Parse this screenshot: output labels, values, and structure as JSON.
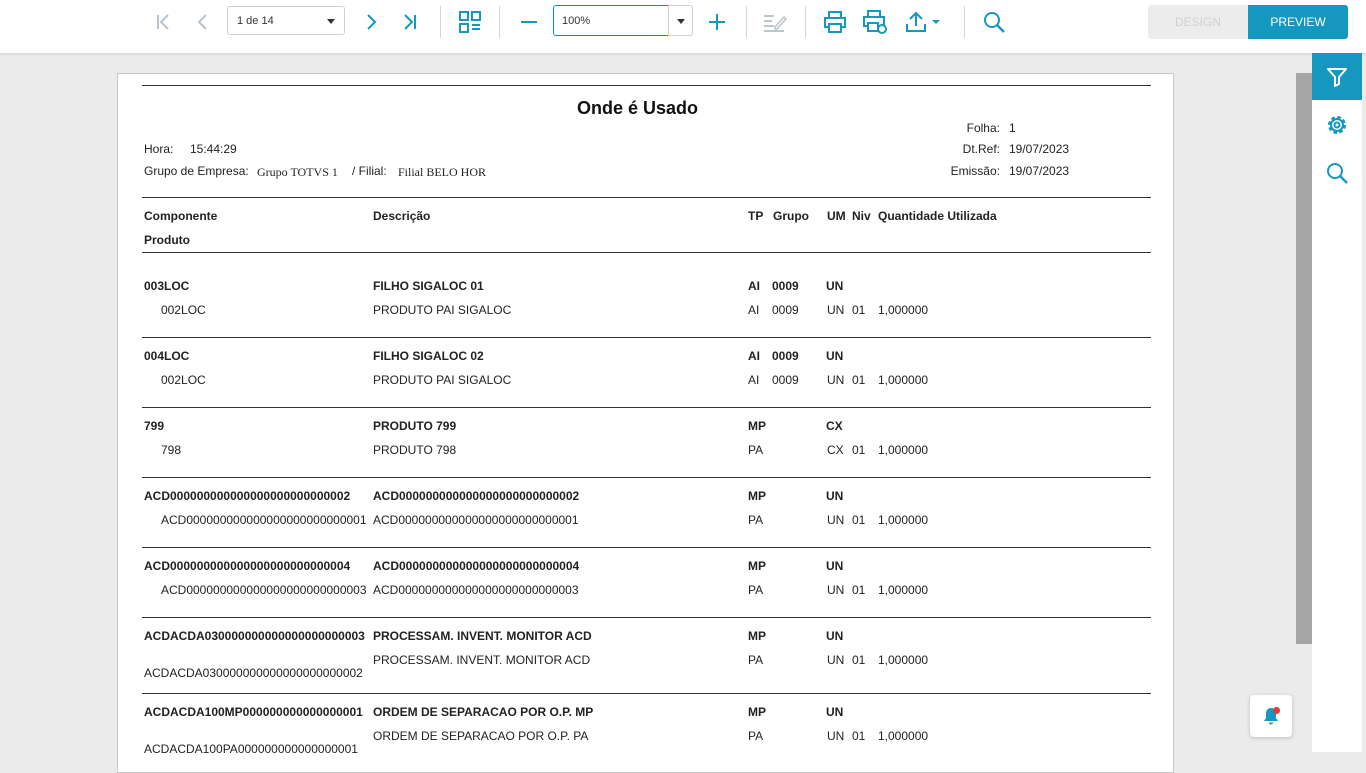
{
  "toolbar": {
    "page_select_value": "1 de 14",
    "zoom_value": "100%",
    "design_label": "DESIGN",
    "preview_label": "PREVIEW"
  },
  "report": {
    "title": "Onde é Usado",
    "hora_label": "Hora:",
    "hora_value": "15:44:29",
    "grupo_label": "Grupo de Empresa:",
    "grupo_value": "Grupo TOTVS 1",
    "filial_label": "/ Filial:",
    "filial_value": "Filial BELO HOR",
    "folha_label": "Folha:",
    "folha_value": "1",
    "dtref_label": "Dt.Ref:",
    "dtref_value": "19/07/2023",
    "emissao_label": "Emissão:",
    "emissao_value": "19/07/2023",
    "columns": {
      "componente": "Componente",
      "produto": "Produto",
      "descricao": "Descrição",
      "tp": "TP",
      "grupo": "Grupo",
      "um": "UM",
      "niv": "Niv",
      "quantidade": "Quantidade Utilizada"
    },
    "items": [
      {
        "comp": {
          "code": "003LOC",
          "desc": "FILHO SIGALOC 01",
          "tp": "AI",
          "grupo": "0009",
          "um": "UN"
        },
        "prod": {
          "code": "002LOC",
          "desc": "PRODUTO PAI SIGALOC",
          "tp": "AI",
          "grupo": "0009",
          "um": "UN",
          "niv": "01",
          "qty": "1,000000"
        }
      },
      {
        "comp": {
          "code": "004LOC",
          "desc": "FILHO SIGALOC 02",
          "tp": "AI",
          "grupo": "0009",
          "um": "UN"
        },
        "prod": {
          "code": "002LOC",
          "desc": "PRODUTO PAI SIGALOC",
          "tp": "AI",
          "grupo": "0009",
          "um": "UN",
          "niv": "01",
          "qty": "1,000000"
        }
      },
      {
        "comp": {
          "code": "799",
          "desc": "PRODUTO 799",
          "tp": "MP",
          "grupo": "",
          "um": "CX"
        },
        "prod": {
          "code": "798",
          "desc": "PRODUTO 798",
          "tp": "PA",
          "grupo": "",
          "um": "CX",
          "niv": "01",
          "qty": "1,000000"
        }
      },
      {
        "comp": {
          "code": "ACD000000000000000000000000002",
          "desc": "ACD000000000000000000000000002",
          "tp": "MP",
          "grupo": "",
          "um": "UN"
        },
        "prod": {
          "code": "ACD000000000000000000000000001",
          "desc": "ACD000000000000000000000000001",
          "tp": "PA",
          "grupo": "",
          "um": "UN",
          "niv": "01",
          "qty": "1,000000"
        }
      },
      {
        "comp": {
          "code": "ACD000000000000000000000000004",
          "desc": "ACD000000000000000000000000004",
          "tp": "MP",
          "grupo": "",
          "um": "UN"
        },
        "prod": {
          "code": "ACD000000000000000000000000003",
          "desc": "ACD000000000000000000000000003",
          "tp": "PA",
          "grupo": "",
          "um": "UN",
          "niv": "01",
          "qty": "1,000000"
        }
      },
      {
        "comp": {
          "code": "ACDACDA030000000000000000000003",
          "desc": "PROCESSAM. INVENT. MONITOR ACD",
          "tp": "MP",
          "grupo": "",
          "um": "UN"
        },
        "prod": {
          "code": "ACDACDA030000000000000000000002",
          "desc": "PROCESSAM. INVENT. MONITOR ACD",
          "tp": "PA",
          "grupo": "",
          "um": "UN",
          "niv": "01",
          "qty": "1,000000"
        }
      },
      {
        "comp": {
          "code": "ACDACDA100MP000000000000000001",
          "desc": "ORDEM DE SEPARACAO POR O.P. MP",
          "tp": "MP",
          "grupo": "",
          "um": "UN"
        },
        "prod": {
          "code": "ACDACDA100PA000000000000000001",
          "desc": "ORDEM DE SEPARACAO POR O.P. PA",
          "tp": "PA",
          "grupo": "",
          "um": "UN",
          "niv": "01",
          "qty": "1,000000"
        }
      }
    ]
  },
  "icons": {
    "first": "first-page-icon",
    "prev": "prev-page-icon",
    "next": "next-page-icon",
    "last": "last-page-icon",
    "thumbs": "thumbnails-icon",
    "zoom_out": "minus-icon",
    "zoom_in": "plus-icon",
    "edit": "edit-icon",
    "print": "print-icon",
    "print_options": "print-settings-icon",
    "export": "export-icon",
    "search": "search-icon",
    "filter": "filter-icon",
    "settings": "gear-icon",
    "panel_search": "search-icon",
    "notifications": "bell-icon"
  },
  "colors": {
    "accent": "#1598bf",
    "muted": "#a9b6bf",
    "notification_dot": "#e53935"
  }
}
